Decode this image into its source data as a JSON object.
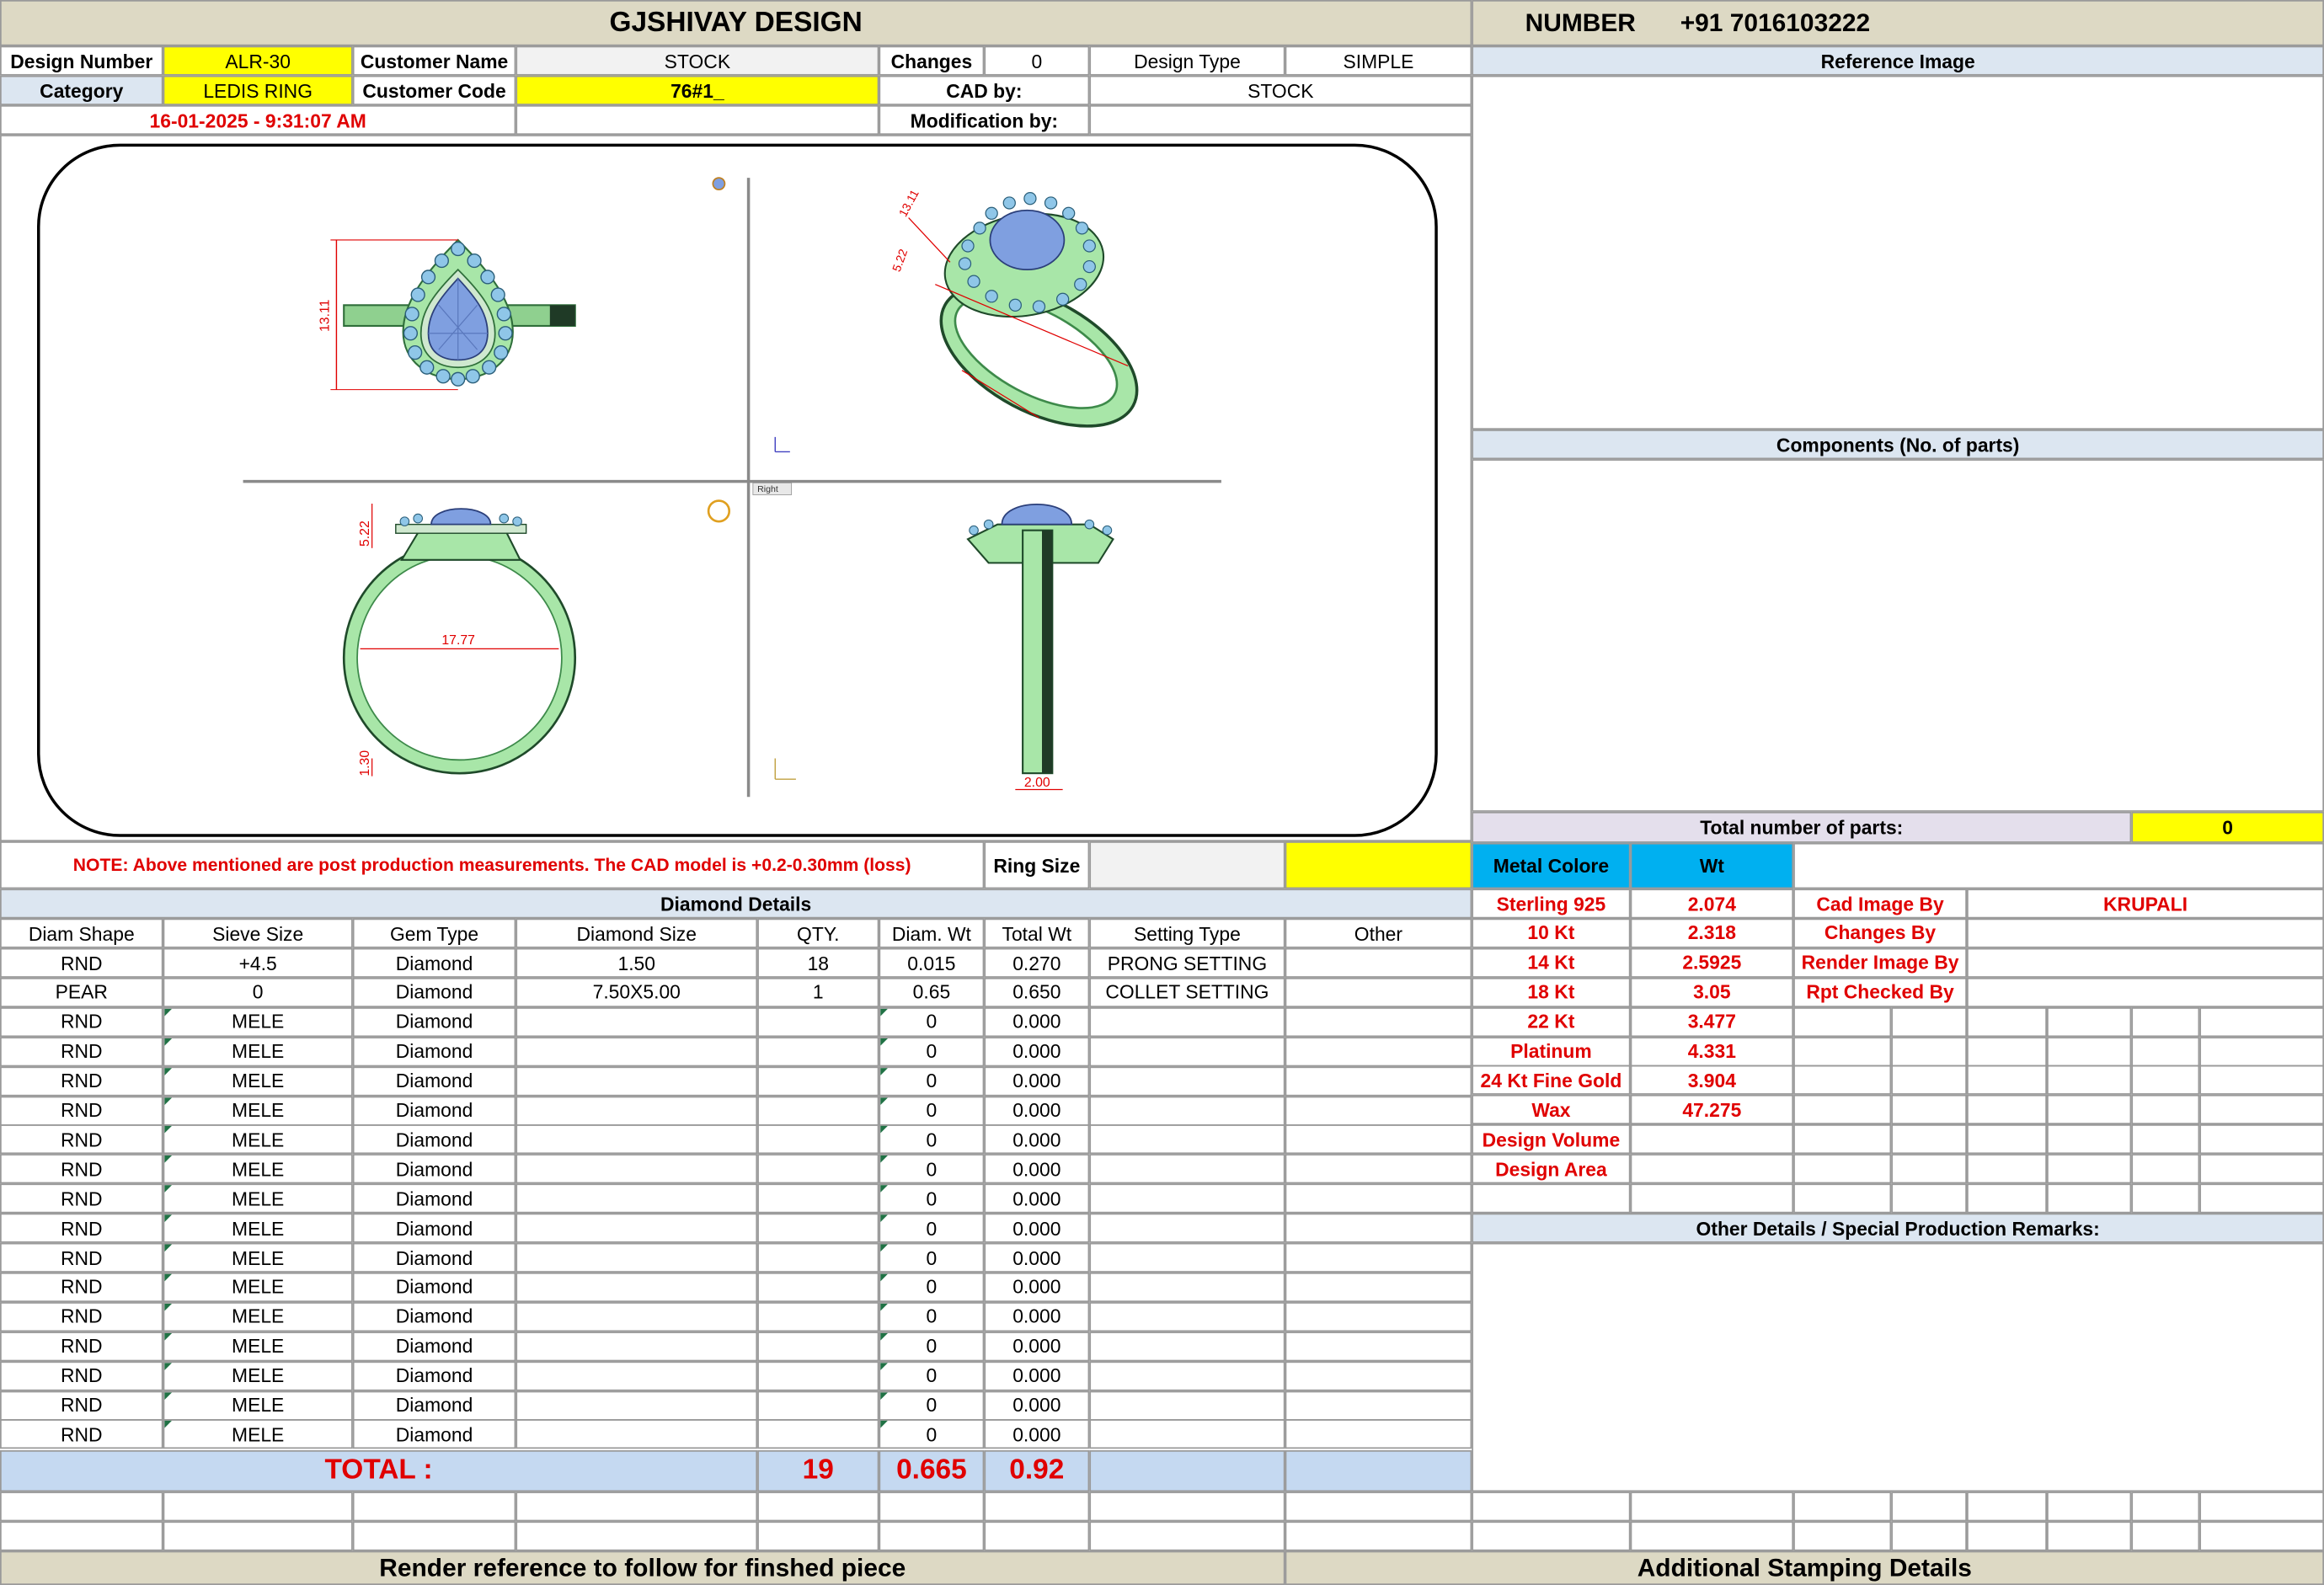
{
  "header": {
    "company": "GJSHIVAY DESIGN",
    "number_label": "NUMBER",
    "number_value": "+91 7016103222"
  },
  "info": {
    "design_number_label": "Design Number",
    "design_number": "ALR-30",
    "customer_name_label": "Customer Name",
    "customer_name": "STOCK",
    "changes_label": "Changes",
    "changes": "0",
    "design_type_label": "Design Type",
    "design_type": "SIMPLE",
    "category_label": "Category",
    "category": "LEDIS RING",
    "customer_code_label": "Customer Code",
    "customer_code": "76#1_",
    "cad_by_label": "CAD by:",
    "cad_by": "STOCK",
    "timestamp": "16-01-2025 - 9:31:07 AM",
    "modification_label": "Modification by:",
    "modification": ""
  },
  "drawing": {
    "dim_front_height": "13.11",
    "dim_side_height": "5.22",
    "dim_inner_diameter": "17.77",
    "dim_band_thickness": "1.30",
    "dim_band_width": "2.00",
    "dim_iso_a": "13.11",
    "dim_iso_b": "5.22",
    "view_label": "Right",
    "colors": {
      "metal": "#a8e6a8",
      "metal_dark": "#3d8a4a",
      "stone": "#7f9fe0",
      "melee": "#8fc6e8",
      "dimension": "#e00000"
    }
  },
  "reference_image_label": "Reference Image",
  "components_label": "Components (No. of parts)",
  "total_parts_label": "Total number of parts:",
  "total_parts": "0",
  "note": "NOTE: Above mentioned are post production measurements. The CAD model is +0.2-0.30mm (loss)",
  "ring_size_label": "Ring Size",
  "ring_size": "",
  "diamond_details_label": "Diamond Details",
  "diamond_headers": [
    "Diam Shape",
    "Sieve Size",
    "Gem Type",
    "Diamond Size",
    "QTY.",
    "Diam. Wt",
    "Total Wt",
    "Setting Type",
    "Other"
  ],
  "diamond_rows": [
    [
      "RND",
      "+4.5",
      "Diamond",
      "1.50",
      "18",
      "0.015",
      "0.270",
      "PRONG SETTING",
      ""
    ],
    [
      "PEAR",
      "0",
      "Diamond",
      "7.50X5.00",
      "1",
      "0.65",
      "0.650",
      "COLLET SETTING",
      ""
    ],
    [
      "RND",
      "MELE",
      "Diamond",
      "",
      "",
      "0",
      "0.000",
      "",
      ""
    ],
    [
      "RND",
      "MELE",
      "Diamond",
      "",
      "",
      "0",
      "0.000",
      "",
      ""
    ],
    [
      "RND",
      "MELE",
      "Diamond",
      "",
      "",
      "0",
      "0.000",
      "",
      ""
    ],
    [
      "RND",
      "MELE",
      "Diamond",
      "",
      "",
      "0",
      "0.000",
      "",
      ""
    ],
    [
      "RND",
      "MELE",
      "Diamond",
      "",
      "",
      "0",
      "0.000",
      "",
      ""
    ],
    [
      "RND",
      "MELE",
      "Diamond",
      "",
      "",
      "0",
      "0.000",
      "",
      ""
    ],
    [
      "RND",
      "MELE",
      "Diamond",
      "",
      "",
      "0",
      "0.000",
      "",
      ""
    ],
    [
      "RND",
      "MELE",
      "Diamond",
      "",
      "",
      "0",
      "0.000",
      "",
      ""
    ],
    [
      "RND",
      "MELE",
      "Diamond",
      "",
      "",
      "0",
      "0.000",
      "",
      ""
    ],
    [
      "RND",
      "MELE",
      "Diamond",
      "",
      "",
      "0",
      "0.000",
      "",
      ""
    ],
    [
      "RND",
      "MELE",
      "Diamond",
      "",
      "",
      "0",
      "0.000",
      "",
      ""
    ],
    [
      "RND",
      "MELE",
      "Diamond",
      "",
      "",
      "0",
      "0.000",
      "",
      ""
    ],
    [
      "RND",
      "MELE",
      "Diamond",
      "",
      "",
      "0",
      "0.000",
      "",
      ""
    ],
    [
      "RND",
      "MELE",
      "Diamond",
      "",
      "",
      "0",
      "0.000",
      "",
      ""
    ],
    [
      "RND",
      "MELE",
      "Diamond",
      "",
      "",
      "0",
      "0.000",
      "",
      ""
    ]
  ],
  "totals": {
    "label": "TOTAL :",
    "qty": "19",
    "diam_wt": "0.665",
    "total_wt": "0.92"
  },
  "metal": {
    "color_label": "Metal Colore",
    "wt_label": "Wt",
    "rows": [
      [
        "Sterling 925",
        "2.074"
      ],
      [
        "10 Kt",
        "2.318"
      ],
      [
        "14 Kt",
        "2.5925"
      ],
      [
        "18 Kt",
        "3.05"
      ],
      [
        "22 Kt",
        "3.477"
      ],
      [
        "Platinum",
        "4.331"
      ],
      [
        "24 Kt Fine Gold",
        "3.904"
      ],
      [
        "Wax",
        "47.275"
      ],
      [
        "Design Volume",
        ""
      ],
      [
        "Design Area",
        ""
      ]
    ]
  },
  "credits": [
    [
      "Cad Image By",
      "KRUPALI"
    ],
    [
      "Changes By",
      ""
    ],
    [
      "Render Image By",
      ""
    ],
    [
      "Rpt Checked By",
      ""
    ]
  ],
  "other_details_label": "Other Details / Special Production Remarks:",
  "footer": {
    "render_reference": "Render reference to follow for finshed piece",
    "additional_stamping": "Additional Stamping Details"
  }
}
